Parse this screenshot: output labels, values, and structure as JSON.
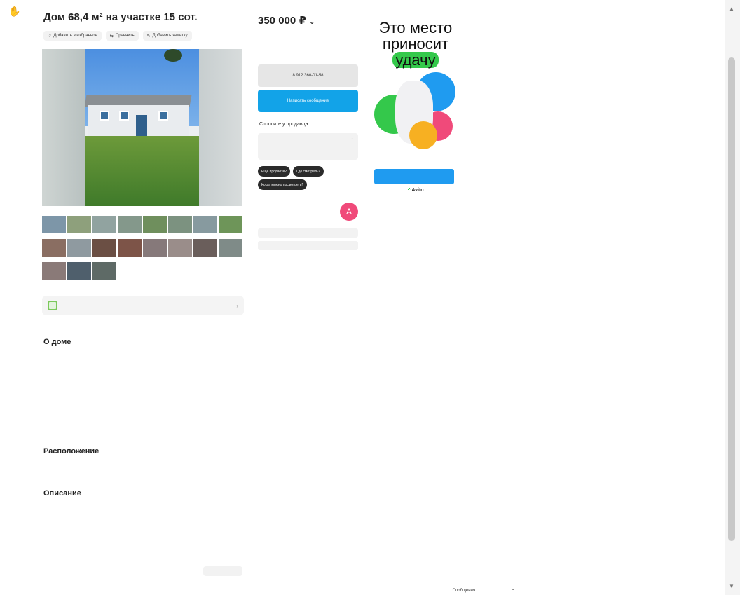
{
  "breadcrumbs": "",
  "title": "Дом 68,4 м² на участке 15 сот.",
  "actions": [
    {
      "label": "Добавить в избранное",
      "icon": "heart-icon"
    },
    {
      "label": "Сравнить",
      "icon": "compare-icon"
    },
    {
      "label": "Добавить заметку",
      "icon": "note-icon"
    }
  ],
  "price": "350 000 ₽",
  "price_sub": "",
  "price_link": "",
  "phone_button": "8 912 360-01-58",
  "message_button": "Написать сообщение",
  "ask_heading": "Спросите у продавца",
  "ask_placeholder": "",
  "chips": [
    "Ещё продаёте?",
    "Где смотреть?",
    "Когда можно посмотреть?"
  ],
  "seller": {
    "name": "",
    "type": "",
    "since": "",
    "avatar_letter": "A"
  },
  "seller_buttons": [
    "",
    ""
  ],
  "video_row": {
    "title": "",
    "subtitle": ""
  },
  "about_heading": "О доме",
  "params_left": [],
  "params_right": [],
  "location_heading": "Расположение",
  "location_text": "",
  "location_link": "",
  "description_heading": "Описание",
  "description_text": "",
  "footer_text": "",
  "footer_button": "",
  "ad": {
    "line1": "Это место",
    "line2": "приносит",
    "highlight": "удачу",
    "button": "",
    "logo": "Avito"
  },
  "message_bar": "Сообщения",
  "colors": {
    "accent_blue": "#12a3e8",
    "avatar_pink": "#f04a7a",
    "ad_green": "#34c84b"
  }
}
